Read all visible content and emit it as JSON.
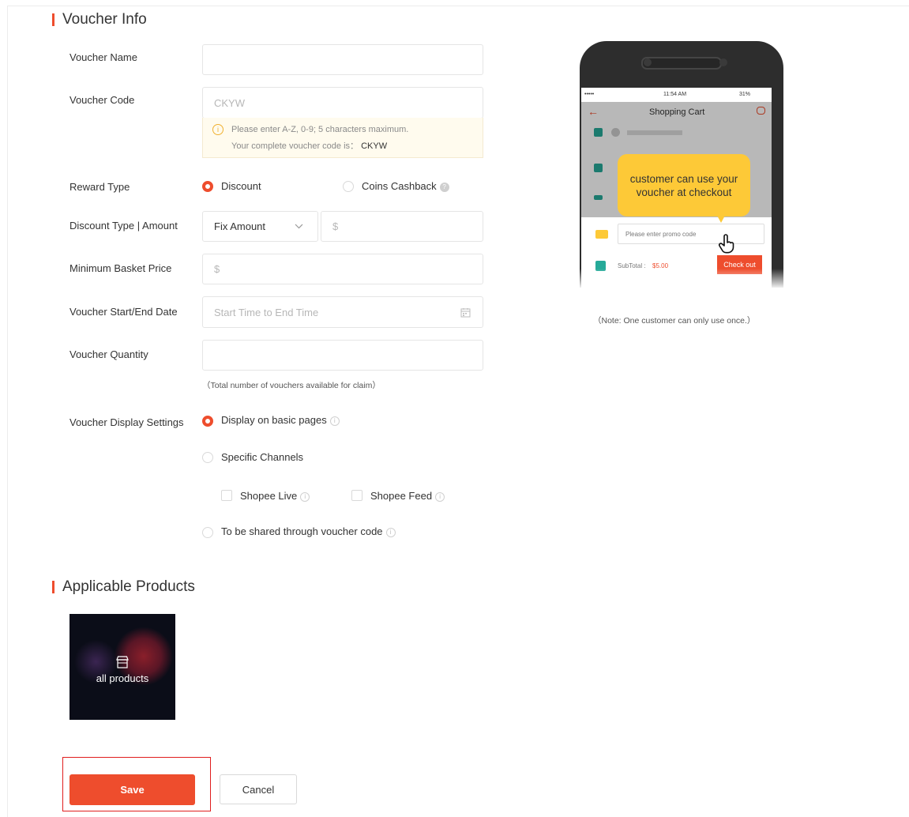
{
  "sections": {
    "voucher_info": "Voucher Info",
    "applicable_products": "Applicable Products"
  },
  "labels": {
    "voucher_name": "Voucher Name",
    "voucher_code": "Voucher Code",
    "reward_type": "Reward Type",
    "discount_type": "Discount Type | Amount",
    "min_basket": "Minimum Basket Price",
    "dates": "Voucher Start/End Date",
    "quantity": "Voucher Quantity",
    "display_settings": "Voucher Display Settings"
  },
  "fields": {
    "voucher_name": "",
    "voucher_code": "CKYW",
    "code_hint_line1": "Please enter A-Z, 0-9; 5 characters maximum.",
    "code_hint_line2_prefix": "Your complete voucher code is：",
    "code_hint_line2_value": "CKYW",
    "discount_type_value": "Fix Amount",
    "amount_placeholder": "$",
    "min_basket_placeholder": "$",
    "dates_placeholder": "Start Time to End Time",
    "quantity_value": "",
    "quantity_hint": "（Total number of vouchers available for claim）"
  },
  "reward_type": {
    "options": [
      "Discount",
      "Coins Cashback"
    ],
    "selected": "Discount"
  },
  "display_settings": {
    "options": [
      "Display on basic pages",
      "Specific Channels",
      "To be shared through voucher code"
    ],
    "selected": "Display on basic pages",
    "channels": [
      "Shopee Live",
      "Shopee Feed"
    ]
  },
  "product_tile": "all products",
  "buttons": {
    "save": "Save",
    "cancel": "Cancel"
  },
  "preview": {
    "status_time": "11:54 AM",
    "status_battery": "31%",
    "cart_title": "Shopping Cart",
    "bubble": "customer can use your voucher at checkout",
    "promo_placeholder": "Please enter promo code",
    "subtotal_label": "SubTotal :",
    "subtotal_value": "$5.00",
    "checkout": "Check out",
    "note": "（Note: One customer can only use once.）"
  },
  "colors": {
    "accent": "#ee4d2d",
    "bubble": "#fdc937",
    "checkbox_green": "#26aa99"
  }
}
